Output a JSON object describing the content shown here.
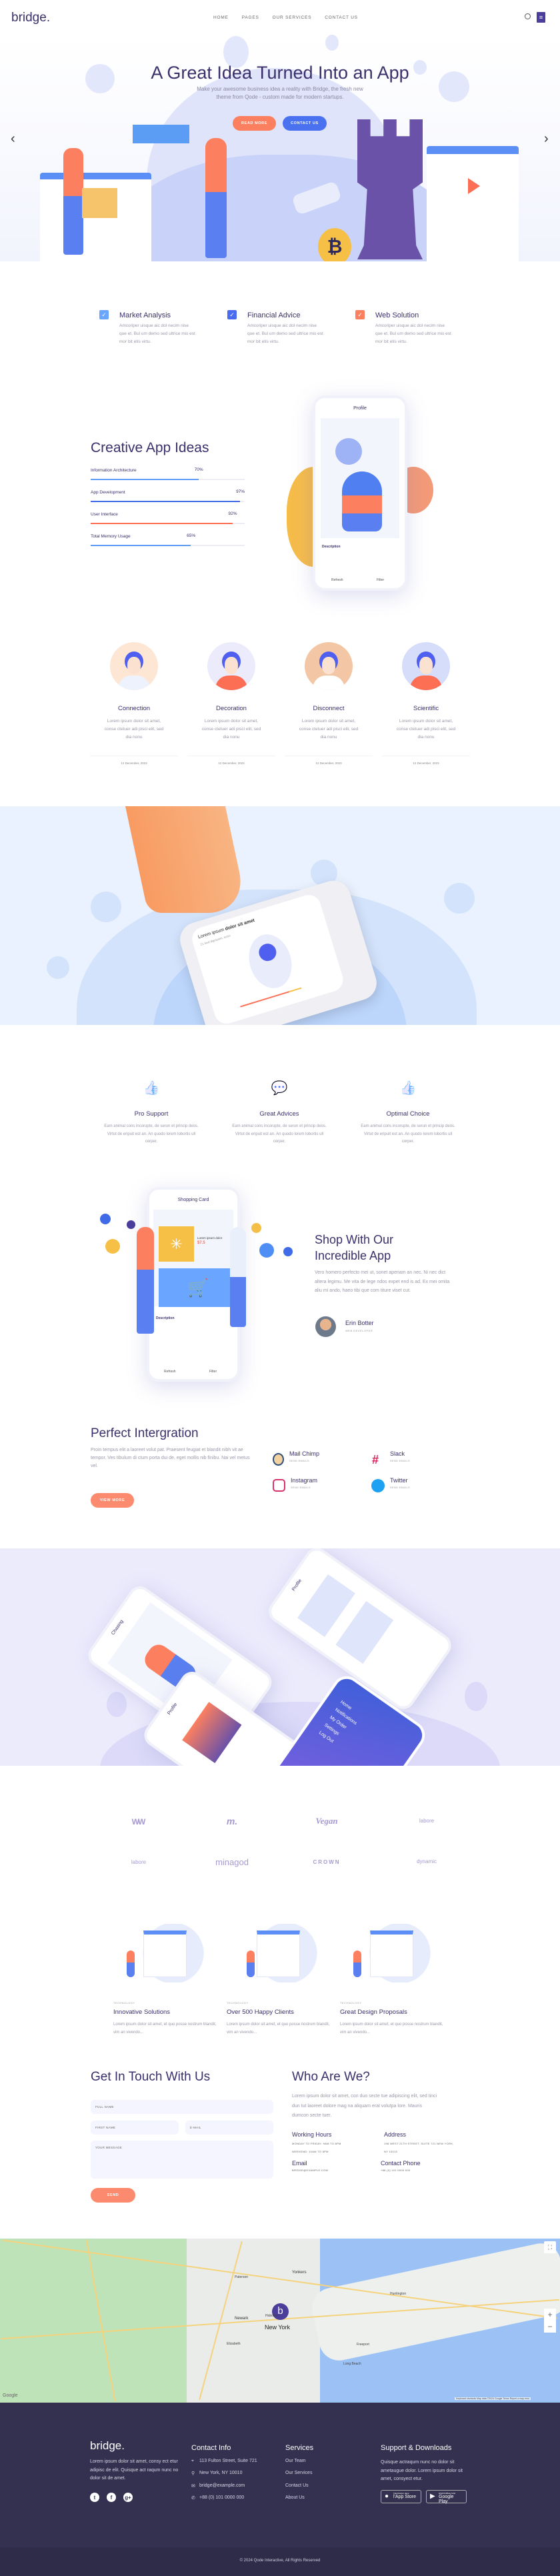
{
  "header": {
    "logo": "bridge.",
    "nav": [
      "HOME",
      "PAGES",
      "OUR SERVICES",
      "CONTACT US"
    ]
  },
  "hero": {
    "title": "A Great Idea Turned Into an App",
    "subtitle_1": "Make your awesome business idea a reality with Bridge, the fresh new",
    "subtitle_2": "theme from Qode - custom made for modern startups.",
    "read_more": "READ MORE",
    "contact_us": "CONTACT US",
    "prev": "‹",
    "next": "›"
  },
  "features": [
    {
      "title": "Market Analysis",
      "text": "Amcoriper uisque aic dol necim nise que et. Bul um demo sed ultrice mis est mor bit etis virtu.",
      "color": "#6aa6ff"
    },
    {
      "title": "Financial Advice",
      "text": "Amcoriper uisque aic dol necim nise que et. Bul um demo sed ultrice mis est mor bit etis virtu.",
      "color": "#4a6cf0"
    },
    {
      "title": "Web Solution",
      "text": "Amcoriper uisque aic dol necim nise que et. Bul um demo sed ultrice mis est mor bit etis virtu.",
      "color": "#fc7f5f"
    }
  ],
  "skills": {
    "title": "Creative App Ideas",
    "items": [
      {
        "label": "Information Architecture",
        "pct": "70%",
        "value": 70,
        "color": "#5e9cf5"
      },
      {
        "label": "App Development",
        "pct": "97%",
        "value": 97,
        "color": "#3f6ae8"
      },
      {
        "label": "User Interface",
        "pct": "92%",
        "value": 92,
        "color": "#fc6f55"
      },
      {
        "label": "Total Memory Usage",
        "pct": "65%",
        "value": 65,
        "color": "#5e9cf5"
      }
    ],
    "phone": {
      "title": "Profile",
      "description": "Description",
      "refresh": "Refresh",
      "filter": "Filter"
    }
  },
  "team": [
    {
      "name": "Connection",
      "text": "Lorem ipsum dolor sit amet, conse ctetuer adi pisci elit, sed dia nonu",
      "date": "12 December, 2023"
    },
    {
      "name": "Decoration",
      "text": "Lorem ipsum dolor sit amet, conse ctetuer adi pisci elit, sed dia nonu",
      "date": "12 December, 2023"
    },
    {
      "name": "Disconnect",
      "text": "Lorem ipsum dolor sit amet, conse ctetuer adi pisci elit, sed dia nonu",
      "date": "12 December, 2023"
    },
    {
      "name": "Scientific",
      "text": "Lorem ipsum dolor sit amet, conse ctetuer adi pisci elit, sed dia nonu",
      "date": "12 December, 2023"
    }
  ],
  "watch": {
    "line1": "Lorem ipsum",
    "line1_bold": "dolor sit amet",
    "line2": "21 Sed dignissim, tortor"
  },
  "services": [
    {
      "title": "Pro Support",
      "text": "Eam animal cons incorupte, de serun et princip deos. Virtut de eripuit est an. An quodo lorem lobortis ull corper.",
      "icon": "thumbs-up"
    },
    {
      "title": "Great Advices",
      "text": "Eam animal cons incorupte, de serun et princip deos. Virtut de eripuit est an. An quodo lorem lobortis ull corper.",
      "icon": "chat-bubble"
    },
    {
      "title": "Optimal Choice",
      "text": "Eam animal cons incorupte, de serun et princip deos. Virtut de eripuit est an. An quodo lorem lobortis ull corper.",
      "icon": "thumbs-up"
    }
  ],
  "shop": {
    "title_1": "Shop With Our",
    "title_2": "Incredible App",
    "text": "Vero homero perfecto mei ut, sonet aperiam an nec. Ni nec dict altera legimu. Me vita de lege ndos expet end is ad. Ex mei omita aliu mi ando, haeo tibi que com titure viset cut.",
    "author": "Erin Botter",
    "role": "WEB DEVELOPER",
    "phone": {
      "title": "Shopping Card",
      "item": "Lorem ipsum dolor",
      "price": "$7.5",
      "description": "Description",
      "refresh": "Refresh",
      "filter": "Filter"
    }
  },
  "integration": {
    "title": "Perfect Intergration",
    "text": "Proin tempus elit a laoreet volut pat. Praesent feugiat et blandit nibh vit ae tempor. Ves tibulum di ctum porta dui de, eget mollis nib finibu. Nai vel metus vel.",
    "button": "VIEW MORE",
    "apps": [
      {
        "name": "Mail Chimp",
        "sub": "SEND EMAILS"
      },
      {
        "name": "Slack",
        "sub": "SEND EMAILS"
      },
      {
        "name": "Instagram",
        "sub": "SEND EMAILS"
      },
      {
        "name": "Twitter",
        "sub": "SEND EMAILS"
      }
    ]
  },
  "app_screens": {
    "screen1": "Chasing",
    "screen2": "Profile",
    "screen3": "Profile",
    "menu": [
      "Home",
      "Notifications",
      "My Order",
      "Settings",
      "Log Out"
    ]
  },
  "clients": [
    "WW",
    "m.",
    "Vegan",
    "labore",
    "labore",
    "minagod",
    "CROWN",
    "dynamic"
  ],
  "blog": [
    {
      "category": "TECHNOLOGY",
      "title": "Innovative Solutions",
      "text": "Lorem ipsum dolor sit amet, et quo posse nostrum blandit, vim an vivendo..."
    },
    {
      "category": "TECHNOLOGY",
      "title": "Over 500 Happy Clients",
      "text": "Lorem ipsum dolor sit amet, et quo posse nostrum blandit, vim an vivendo..."
    },
    {
      "category": "TECHNOLOGY",
      "title": "Great Design Proposals",
      "text": "Lorem ipsum dolor sit amet, et quo posse nostrum blandit, vim an vivendo..."
    }
  ],
  "contact": {
    "title": "Get In Touch With Us",
    "full_name": "FULL NAME",
    "first_name": "FIRST NAME",
    "email": "E-MAIL",
    "message": "YOUR MESSAGE",
    "send": "SEND"
  },
  "about": {
    "title": "Who Are We?",
    "text": "Lorem ipsum dolor sit amet, con duo secte tue adipiscing elit, sed tinci dun tut laoreet dolore mag na aliquam erat volutpa lore. Mauris dumcon secte tuer.",
    "hours_title": "Working Hours",
    "hours_1": "MONDAY TO FRIDAY: 9AM TO 8PM",
    "hours_2": "WEEKEND: 10AM TO 5PM",
    "address_title": "Address",
    "address": "198 WEST 21TH STREET, SUITE 721 NEW YORK, NY 10010",
    "email_title": "Email",
    "email": "BRIDGE@EXAMPLE.COM",
    "phone_title": "Contact Phone",
    "phone": "+88 (0) 101 0000 000"
  },
  "map": {
    "city": "New York",
    "labels": [
      "Newark",
      "Yonkers",
      "Paterson",
      "Hoboken",
      "Elizabeth",
      "Huntington",
      "Long Beach",
      "Freeport"
    ],
    "zoom_in": "+",
    "zoom_out": "−",
    "marker": "b",
    "footer": "Keyboard shortcuts  Map data ©2024 Google  Terms  Report a map error",
    "google": "Google"
  },
  "footer": {
    "logo": "bridge.",
    "about": "Lorem ipsum dolor sit amet, consy ect etur adipisc de elit. Quisque act raqum nunc no dolor sit de amet.",
    "contact_title": "Contact Info",
    "contact": [
      "113 Fulton Street, Suite 721",
      "New York, NY 10010",
      "bridge@example.com",
      "+88 (0) 101 0000 000"
    ],
    "services_title": "Services",
    "services": [
      "Our Team",
      "Our Services",
      "Contact Us",
      "About Us"
    ],
    "support_title": "Support & Downloads",
    "support_text": "Quisque actraqum nunc no dolor sit ametaugue dolor. Lorem ipsum dolor sit amet, consyect etur.",
    "app_store_small": "Télécharger dans",
    "app_store": "l'App Store",
    "google_small": "DISPONIBLE SUR",
    "google_play": "Google Play",
    "copyright": "© 2024 Qode Interactive, All Rights Reserved"
  },
  "colors": {
    "primary": "#3a2f6b",
    "accent": "#fc8a6e",
    "blue": "#4a6cf0",
    "footer": "#33314f"
  }
}
